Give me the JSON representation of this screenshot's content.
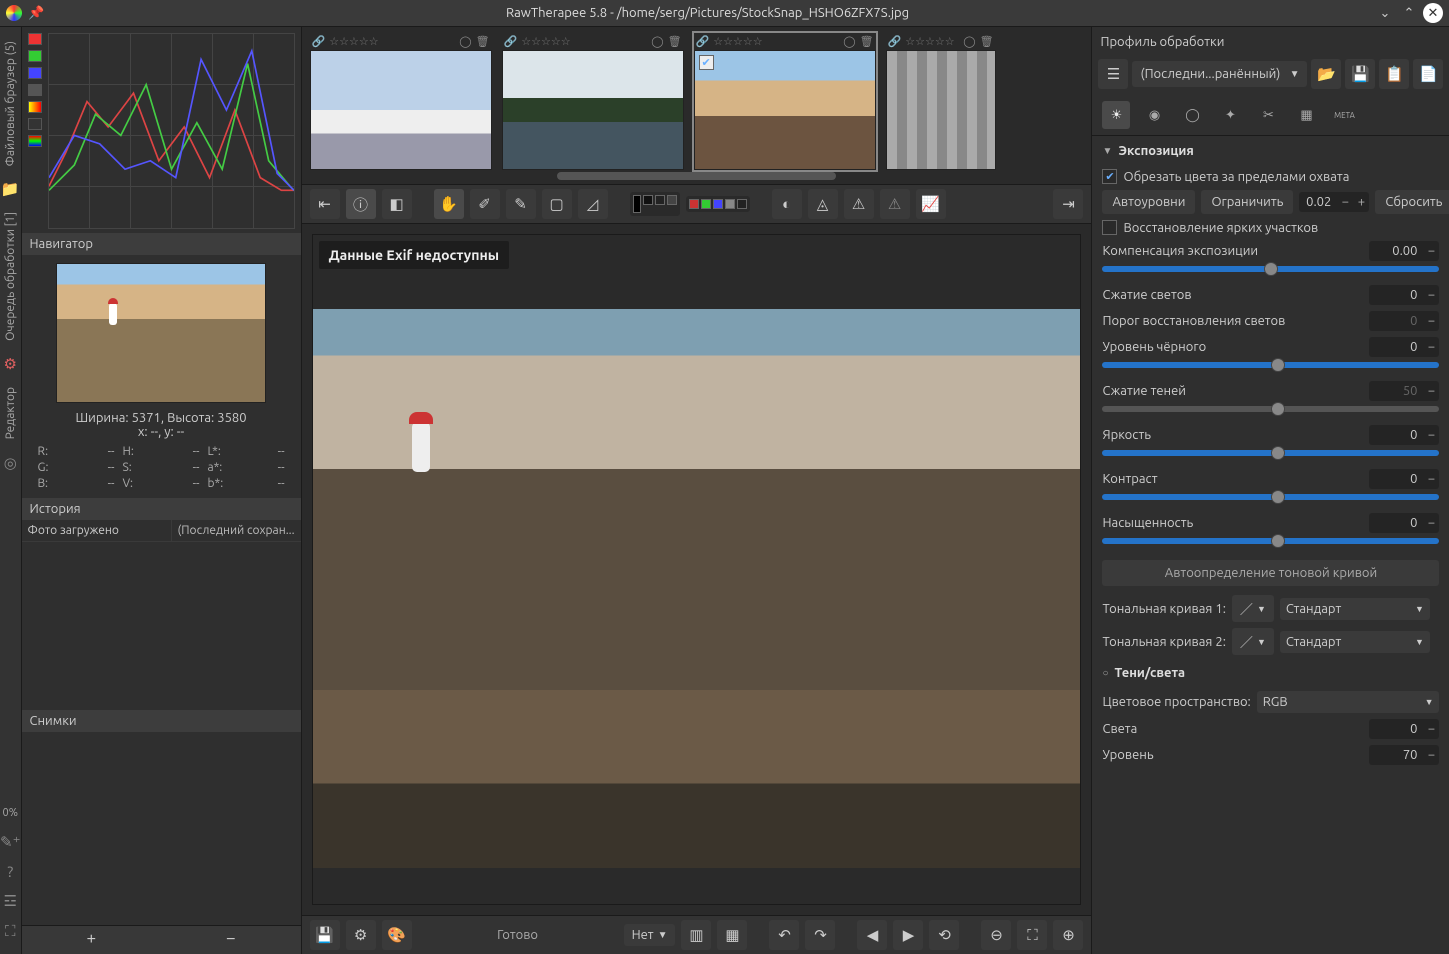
{
  "titlebar": {
    "title": "RawTherapee 5.8 - /home/serg/Pictures/StockSnap_HSHO6ZFX7S.jpg"
  },
  "sidebar_tabs": {
    "file_browser": "Файловый браузер (5)",
    "queue": "Очередь обработки [1]",
    "editor": "Редактор",
    "progress": "0%"
  },
  "navigator": {
    "header": "Навигатор",
    "dimensions": "Ширина: 5371, Высота: 3580",
    "position": "x: --, y: --",
    "channels": {
      "R": "R:",
      "rval": "--",
      "G": "G:",
      "gval": "--",
      "B": "B:",
      "bval": "--",
      "H": "H:",
      "hval": "--",
      "S": "S:",
      "sval": "--",
      "V": "V:",
      "vval": "--",
      "Lc": "L*:",
      "lcval": "--",
      "ac": "a*:",
      "acval": "--",
      "bc": "b*:",
      "bcval": "--"
    }
  },
  "history": {
    "header": "История",
    "entry_name": "Фото загружено",
    "entry_val": "(Последний сохран..."
  },
  "snapshots": {
    "header": "Снимки"
  },
  "exif_note": "Данные Exif недоступны",
  "statusbar": {
    "ready": "Готово",
    "bg_select": "Нет"
  },
  "profile": {
    "header": "Профиль обработки",
    "value": "(Последни...ранённый)"
  },
  "exposure": {
    "header": "Экспозиция",
    "clip_label": "Обрезать цвета за пределами охвата",
    "auto_levels": "Автоуровни",
    "clip_btn": "Ограничить",
    "clip_val": "0.02",
    "reset": "Сбросить",
    "highlight_recon": "Восстановление ярких участков",
    "ev_comp": "Компенсация экспозиции",
    "ev_comp_val": "0.00",
    "hl_compress": "Сжатие светов",
    "hl_compress_val": "0",
    "hl_thresh": "Порог восстановления светов",
    "hl_thresh_val": "0",
    "black": "Уровень чёрного",
    "black_val": "0",
    "sh_compress": "Сжатие теней",
    "sh_compress_val": "50",
    "brightness": "Яркость",
    "brightness_val": "0",
    "contrast": "Контраст",
    "contrast_val": "0",
    "saturation": "Насыщенность",
    "saturation_val": "0",
    "auto_tone_curve": "Автоопределение тоновой кривой",
    "tone_curve_1": "Тональная кривая 1:",
    "tone_curve_2": "Тональная кривая 2:",
    "curve_mode": "Стандарт"
  },
  "shadows_highlights": {
    "header": "Тени/света",
    "colorspace_lab": "Цветовое пространство:",
    "colorspace_val": "RGB",
    "highlights": "Света",
    "highlights_val": "0",
    "level": "Уровень",
    "level_val": "70"
  }
}
